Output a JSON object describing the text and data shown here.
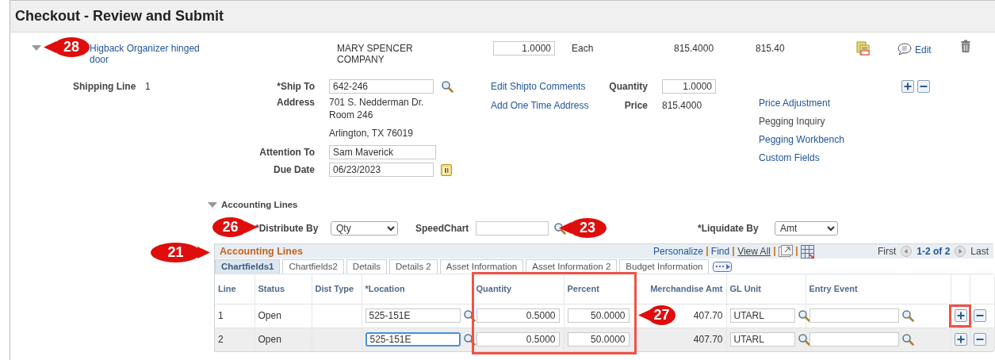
{
  "title": "Checkout - Review and Submit",
  "item": {
    "expanded": true,
    "description": "Higback Organizer hinged door",
    "supplier": "MARY SPENCER COMPANY",
    "quantity": "1.0000",
    "uom": "Each",
    "price": "815.4000",
    "amount": "815.40",
    "comment_link": "Edit"
  },
  "shipping": {
    "label": "Shipping Line",
    "line": "1",
    "ship_to": {
      "label": "*Ship To",
      "value": "642-246"
    },
    "address": {
      "label": "Address",
      "lines": [
        "701 S. Nedderman Dr.",
        "Room 246",
        "Arlington, TX  76019"
      ]
    },
    "attention_to": {
      "label": "Attention To",
      "value": "Sam Maverick"
    },
    "due_date": {
      "label": "Due Date",
      "value": "06/23/2023"
    },
    "links": [
      "Edit Shipto Comments",
      "Add One Time Address"
    ],
    "quantity": {
      "label": "Quantity",
      "value": "1.0000"
    },
    "price": {
      "label": "Price",
      "value": "815.4000"
    },
    "actions": [
      {
        "label": "Price Adjustment",
        "enabled": true
      },
      {
        "label": "Pegging Inquiry",
        "enabled": false
      },
      {
        "label": "Pegging Workbench",
        "enabled": true
      },
      {
        "label": "Custom Fields",
        "enabled": true
      }
    ]
  },
  "accounting": {
    "label": "Accounting Lines",
    "expanded": true,
    "distribute_by": {
      "label": "*Distribute By",
      "value": "Qty"
    },
    "speedchart": {
      "label": "SpeedChart"
    },
    "liquidate_by": {
      "label": "*Liquidate By",
      "value": "Amt"
    },
    "grid": {
      "title": "Accounting Lines",
      "toolbar": [
        {
          "label": "Personalize",
          "enabled": true
        },
        {
          "label": "Find",
          "enabled": true
        },
        {
          "label": "View All",
          "enabled": false
        }
      ],
      "first": "First",
      "range": "1-2 of 2",
      "last": "Last",
      "tabs": [
        {
          "label": "Chartfields1",
          "selected": true
        },
        {
          "label": "Chartfields2",
          "selected": false
        },
        {
          "label": "Details",
          "selected": false
        },
        {
          "label": "Details 2",
          "selected": false
        },
        {
          "label": "Asset Information",
          "selected": false
        },
        {
          "label": "Asset Information 2",
          "selected": false
        },
        {
          "label": "Budget Information",
          "selected": false
        }
      ],
      "columns": [
        "Line",
        "Status",
        "Dist Type",
        "*Location",
        "Quantity",
        "Percent",
        "Merchandise Amt",
        "GL Unit",
        "Entry Event"
      ],
      "rows": [
        {
          "line": "1",
          "status": "Open",
          "location": "525-151E",
          "quantity": "0.5000",
          "percent": "50.0000",
          "merchandise_amt": "407.70",
          "gl_unit": "UTARL",
          "focused": false
        },
        {
          "line": "2",
          "status": "Open",
          "location": "525-151E",
          "quantity": "0.5000",
          "percent": "50.0000",
          "merchandise_amt": "407.70",
          "gl_unit": "UTARL",
          "focused": true
        }
      ]
    }
  },
  "callouts": [
    {
      "label": "28",
      "kind": "left"
    },
    {
      "label": "26",
      "kind": "right"
    },
    {
      "label": "23",
      "kind": "left"
    },
    {
      "label": "21",
      "kind": "right"
    },
    {
      "label": "27",
      "kind": "left"
    }
  ]
}
